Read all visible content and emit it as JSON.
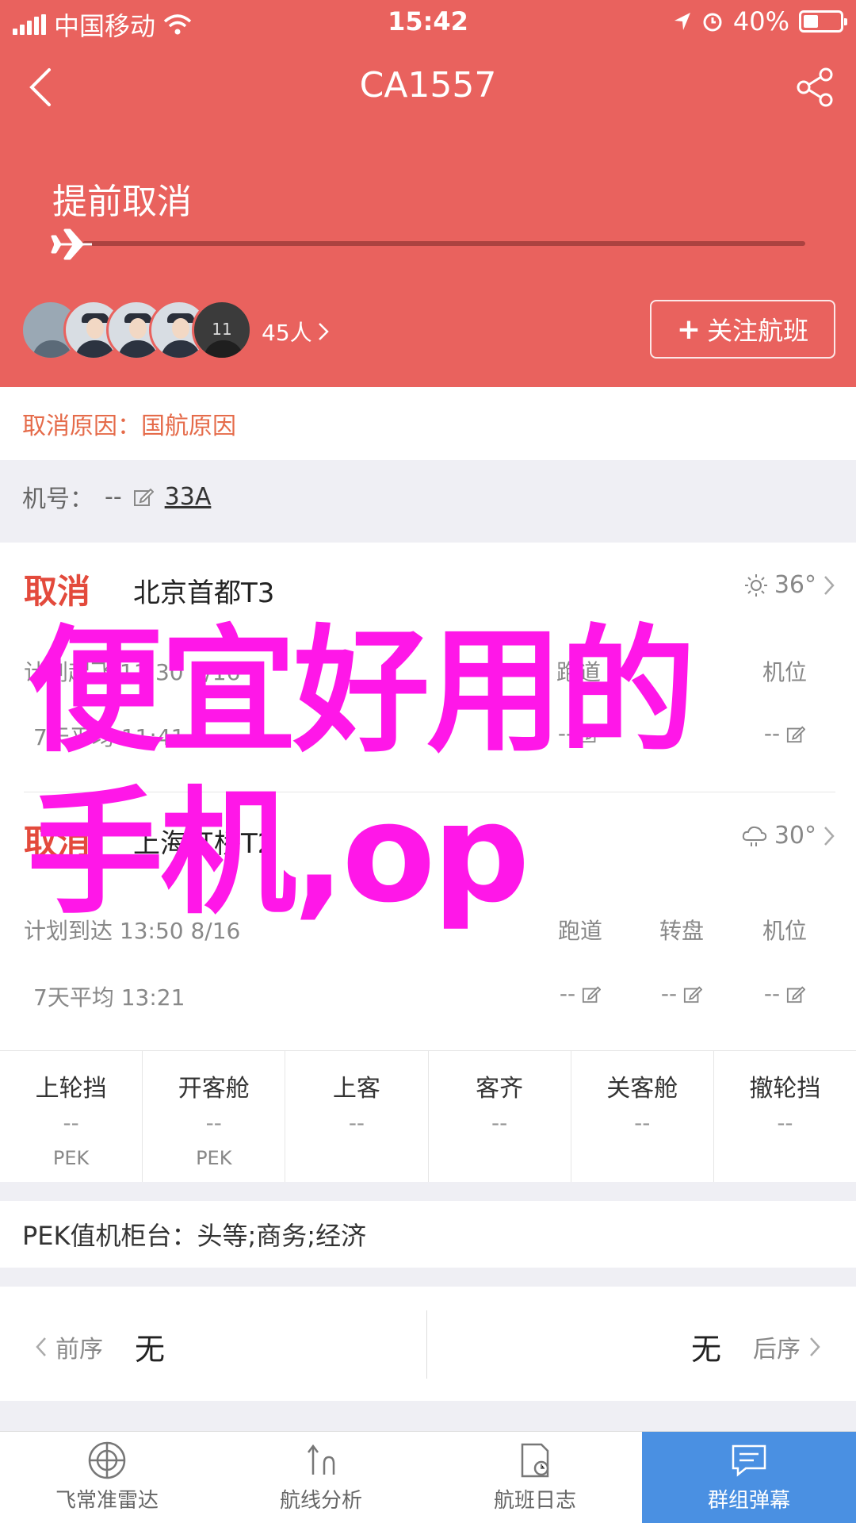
{
  "status_bar": {
    "carrier": "中国移动",
    "time": "15:42",
    "battery": "40%",
    "battery_level": 0.4
  },
  "nav": {
    "title": "CA1557"
  },
  "flight": {
    "status": "提前取消",
    "progress": 0.0,
    "followers_count": "45人",
    "follow_button": "关注航班",
    "avatar_jersey_number": "11"
  },
  "cancel_reason": "取消原因：国航原因",
  "registration": {
    "label": "机号：",
    "value": "--",
    "aircraft_type": "33A"
  },
  "departure": {
    "status": "取消",
    "airport": "北京首都T3",
    "temperature": "36°",
    "weather_icon": "sun-icon",
    "planned_label": "计划起飞 11:30 6/16",
    "avg_label": "7天平均 11:41",
    "col_runway": "跑道",
    "col_stand": "机位",
    "runway": "--",
    "stand": "--"
  },
  "arrival": {
    "status": "取消",
    "airport": "上海虹桥T2",
    "temperature": "30°",
    "weather_icon": "cloud-rain-icon",
    "planned_label": "计划到达 13:50 8/16",
    "avg_label": "7天平均 13:21",
    "col_runway": "跑道",
    "col_carousel": "转盘",
    "col_stand": "机位",
    "runway": "--",
    "carousel": "--",
    "stand": "--"
  },
  "stages": [
    {
      "label": "上轮挡",
      "time": "--",
      "place": "PEK"
    },
    {
      "label": "开客舱",
      "time": "--",
      "place": "PEK"
    },
    {
      "label": "上客",
      "time": "--",
      "place": ""
    },
    {
      "label": "客齐",
      "time": "--",
      "place": ""
    },
    {
      "label": "关客舱",
      "time": "--",
      "place": ""
    },
    {
      "label": "撤轮挡",
      "time": "--",
      "place": ""
    }
  ],
  "checkin_counter": "PEK值机柜台：头等;商务;经济",
  "prev_next": {
    "prev_label": "前序",
    "prev_value": "无",
    "next_label": "后序",
    "next_value": "无"
  },
  "tabs": [
    {
      "label": "飞常准雷达",
      "icon": "radar-icon"
    },
    {
      "label": "航线分析",
      "icon": "route-icon"
    },
    {
      "label": "航班日志",
      "icon": "log-icon"
    },
    {
      "label": "群组弹幕",
      "icon": "chat-icon"
    }
  ],
  "watermark": {
    "line1": "便宜好用的",
    "line2": "手机,op"
  },
  "colors": {
    "header": "#e9625e",
    "accent_red": "#e34a3c",
    "reason_text": "#e56b4a",
    "tab_active": "#4a90e2",
    "watermark": "#ff17e8"
  }
}
